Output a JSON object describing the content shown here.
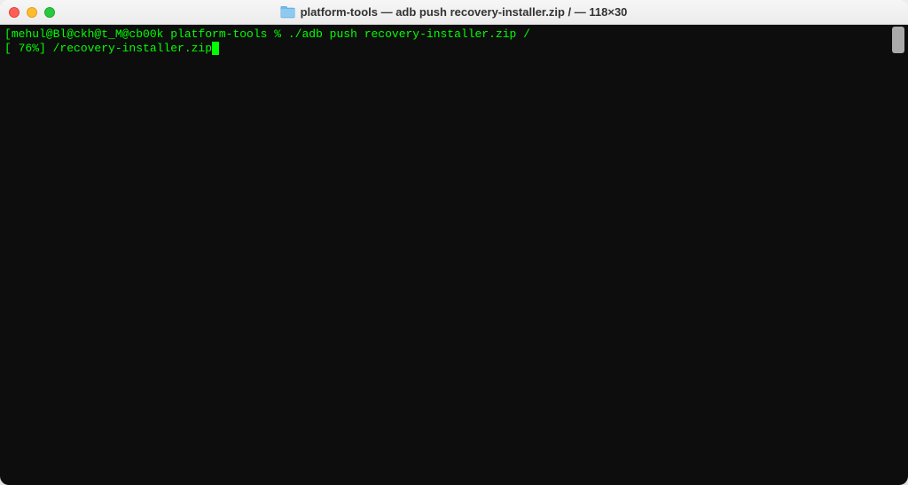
{
  "window": {
    "title": "platform-tools — adb push recovery-installer.zip / — 118×30"
  },
  "terminal": {
    "line1": {
      "bracket_open": "[",
      "prompt": "mehul@Bl@ckh@t_M@cb00k platform-tools % ",
      "command": "./adb push recovery-installer.zip /"
    },
    "line2": {
      "progress": "[ 76%] /recovery-installer.zip"
    }
  },
  "colors": {
    "terminal_bg": "#0d0d0d",
    "terminal_fg": "#00ff00"
  }
}
